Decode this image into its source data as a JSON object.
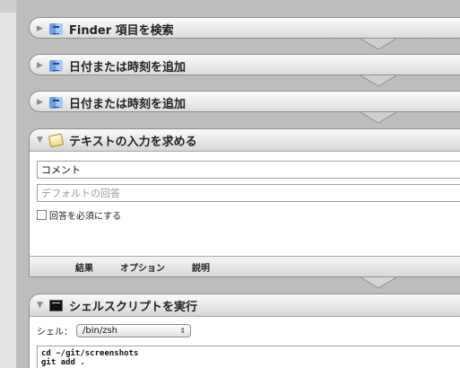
{
  "actions": [
    {
      "title": "Finder 項目を検索",
      "icon": "finder-icon",
      "state": "collapsed"
    },
    {
      "title": "日付または時刻を追加",
      "icon": "finder-icon",
      "state": "collapsed"
    },
    {
      "title": "日付または時刻を追加",
      "icon": "finder-icon",
      "state": "collapsed"
    },
    {
      "title": "テキストの入力を求める",
      "icon": "note-icon",
      "state": "expanded",
      "comment_value": "コメント",
      "default_answer_placeholder": "デフォルトの回答",
      "require_answer_label": "回答を必須にする",
      "require_answer_checked": false,
      "tabs": [
        "結果",
        "オプション",
        "説明"
      ]
    },
    {
      "title": "シェルスクリプトを実行",
      "icon": "terminal-icon",
      "state": "expanded",
      "shell_label": "シェル：",
      "shell_value": "/bin/zsh",
      "script": "cd ~/git/screenshots\ngit add ."
    }
  ],
  "glyphs": {
    "expand": "▶",
    "collapse": "▼",
    "popup_arrows": "⇕"
  }
}
